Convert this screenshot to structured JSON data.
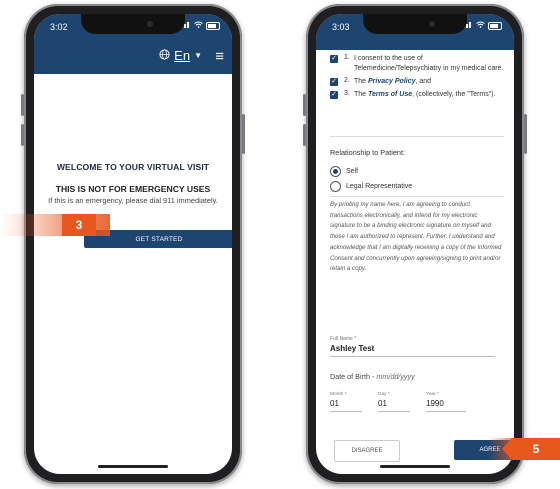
{
  "left_phone": {
    "time": "3:02",
    "language": "En",
    "welcome_title": "WELCOME TO YOUR VIRTUAL VISIT",
    "not_for_emergency": "THIS IS NOT FOR EMERGENCY USES",
    "emergency_note": "If this is an emergency, please dial 911 immediately.",
    "get_started_label": "GET STARTED"
  },
  "right_phone": {
    "time": "3:03",
    "consents": [
      {
        "num": "1.",
        "text": "I consent to the use of Telemedicine/Telepsychiatry in my medical care."
      },
      {
        "num": "2.",
        "pre": "The ",
        "link": "Privacy Policy",
        "post": ", and"
      },
      {
        "num": "3.",
        "pre": "The ",
        "link": "Terms of Use",
        "post": ", (collectively, the \"Terms\")."
      }
    ],
    "relationship_label": "Relationship to Patient:",
    "radio_self": "Self",
    "radio_legal": "Legal Representative",
    "legal_text": "By printing my name here, I am agreeing to conduct transactions electronically, and intend for my electronic signature to be a binding electronic signature on myself and those I am authorized to represent. Further, I understand and acknowledge that I am digitally receiving a copy of the Informed Consent and concurrently upon agreeing/signing to print and/or retain a copy.",
    "full_name_label": "Full Name",
    "full_name_value": "Ashley Test",
    "dob_label": "Date of Birth -",
    "dob_format": "mm/dd/yyyy",
    "dob_month_label": "Month",
    "dob_month": "01",
    "dob_day_label": "Day",
    "dob_day": "01",
    "dob_year_label": "Year",
    "dob_year": "1990",
    "disagree_label": "DISAGREE",
    "agree_label": "AGREE"
  },
  "callouts": {
    "step_a": "3",
    "step_b": "5"
  },
  "colors": {
    "brand_navy": "#1e4470",
    "callout_orange": "#e8571e"
  }
}
